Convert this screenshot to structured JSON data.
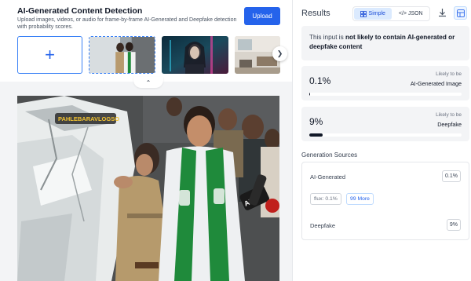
{
  "header": {
    "title": "AI-Generated Content Detection",
    "subtitle": "Upload images, videos, or audio for frame-by-frame AI-Generated and Deepfake detection with probability scores.",
    "upload_label": "Upload"
  },
  "gallery": {
    "add_icon": "plus-icon",
    "next_icon": "chevron-right-icon"
  },
  "viewer": {
    "collapse_icon": "chevron-up-icon",
    "overlay_text": "PAHLEBARAVLOGSO"
  },
  "results": {
    "title": "Results",
    "view_toggle": {
      "simple": "Simple",
      "json": "</> JSON",
      "selected": "Simple"
    },
    "verdict": {
      "prefix": "This input is ",
      "emphasis": "not likely to contain AI-generated or deepfake content"
    },
    "scores": [
      {
        "value": "0.1%",
        "likely_label": "Likely to be",
        "name": "AI-Generated Image",
        "fraction": 0.001
      },
      {
        "value": "9%",
        "likely_label": "Likely to be",
        "name": "Deepfake",
        "fraction": 0.09
      }
    ],
    "generation_sources": {
      "title": "Generation Sources",
      "ai_generated_label": "AI-Generated",
      "ai_generated_value": "0.1%",
      "chips": [
        "flux: 0.1%"
      ],
      "more_label": "99 More",
      "deepfake_label": "Deepfake",
      "deepfake_value": "9%"
    }
  },
  "colors": {
    "accent": "#2563eb",
    "panel_bg": "#f3f4f6",
    "bar_fill": "#111827",
    "scarf_green": "#1f8a3b"
  }
}
